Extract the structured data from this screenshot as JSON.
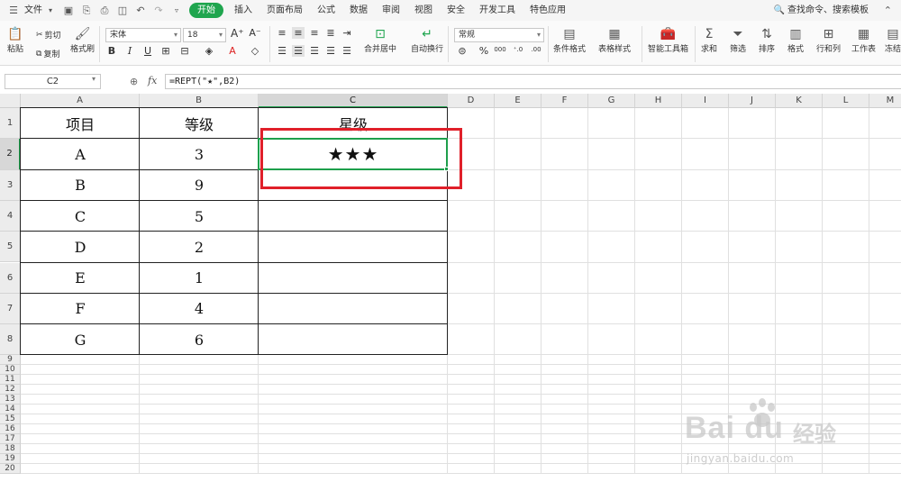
{
  "menubar": {
    "file_label": "文件",
    "tabs": [
      {
        "label": "开始",
        "active": true
      },
      {
        "label": "插入"
      },
      {
        "label": "页面布局"
      },
      {
        "label": "公式"
      },
      {
        "label": "数据"
      },
      {
        "label": "审阅"
      },
      {
        "label": "视图"
      },
      {
        "label": "安全"
      },
      {
        "label": "开发工具"
      },
      {
        "label": "特色应用"
      }
    ],
    "search_label": "查找命令、搜索模板",
    "accent": "#1fa54e"
  },
  "ribbon": {
    "paste": "粘贴",
    "cut": "剪切",
    "copy": "复制",
    "format_painter": "格式刷",
    "font_name": "宋体",
    "font_size": "18",
    "bold": "B",
    "italic": "I",
    "underline": "U",
    "merge_center": "合并居中",
    "wrap_text": "自动换行",
    "number_format": "常规",
    "percent": "%",
    "thousands": "000",
    "inc_decimal": ".0\n.00",
    "dec_decimal": ".00",
    "conditional_format": "条件格式",
    "table_style": "表格样式",
    "smart_toolbox": "智能工具箱",
    "sum": "求和",
    "filter": "筛选",
    "sort": "排序",
    "format": "格式",
    "row_col": "行和列",
    "worksheet": "工作表",
    "freeze": "冻结"
  },
  "formulabar": {
    "cell_ref": "C2",
    "fx": "fx",
    "formula": "=REPT(\"★\",B2)"
  },
  "grid": {
    "columns": [
      "A",
      "B",
      "C",
      "D",
      "E",
      "F",
      "G",
      "H",
      "I",
      "J",
      "K",
      "L",
      "M"
    ],
    "rows": [
      "1",
      "2",
      "3",
      "4",
      "5",
      "6",
      "7",
      "8",
      "9",
      "10",
      "11",
      "12",
      "13",
      "14",
      "15",
      "16",
      "17",
      "18",
      "19",
      "20"
    ],
    "selected_col": "C",
    "selected_row": "2",
    "active_color": "#1e9f4c"
  },
  "table": {
    "headers": [
      "项目",
      "等级",
      "星级"
    ],
    "rows": [
      {
        "item": "A",
        "level": "3",
        "stars": "★★★"
      },
      {
        "item": "B",
        "level": "9",
        "stars": ""
      },
      {
        "item": "C",
        "level": "5",
        "stars": ""
      },
      {
        "item": "D",
        "level": "2",
        "stars": ""
      },
      {
        "item": "E",
        "level": "1",
        "stars": ""
      },
      {
        "item": "F",
        "level": "4",
        "stars": ""
      },
      {
        "item": "G",
        "level": "6",
        "stars": ""
      }
    ]
  },
  "annotation": {
    "color": "#e0202a"
  },
  "watermark": {
    "brand": "Bai du",
    "cn": "经验",
    "url": "jingyan.baidu.com"
  }
}
